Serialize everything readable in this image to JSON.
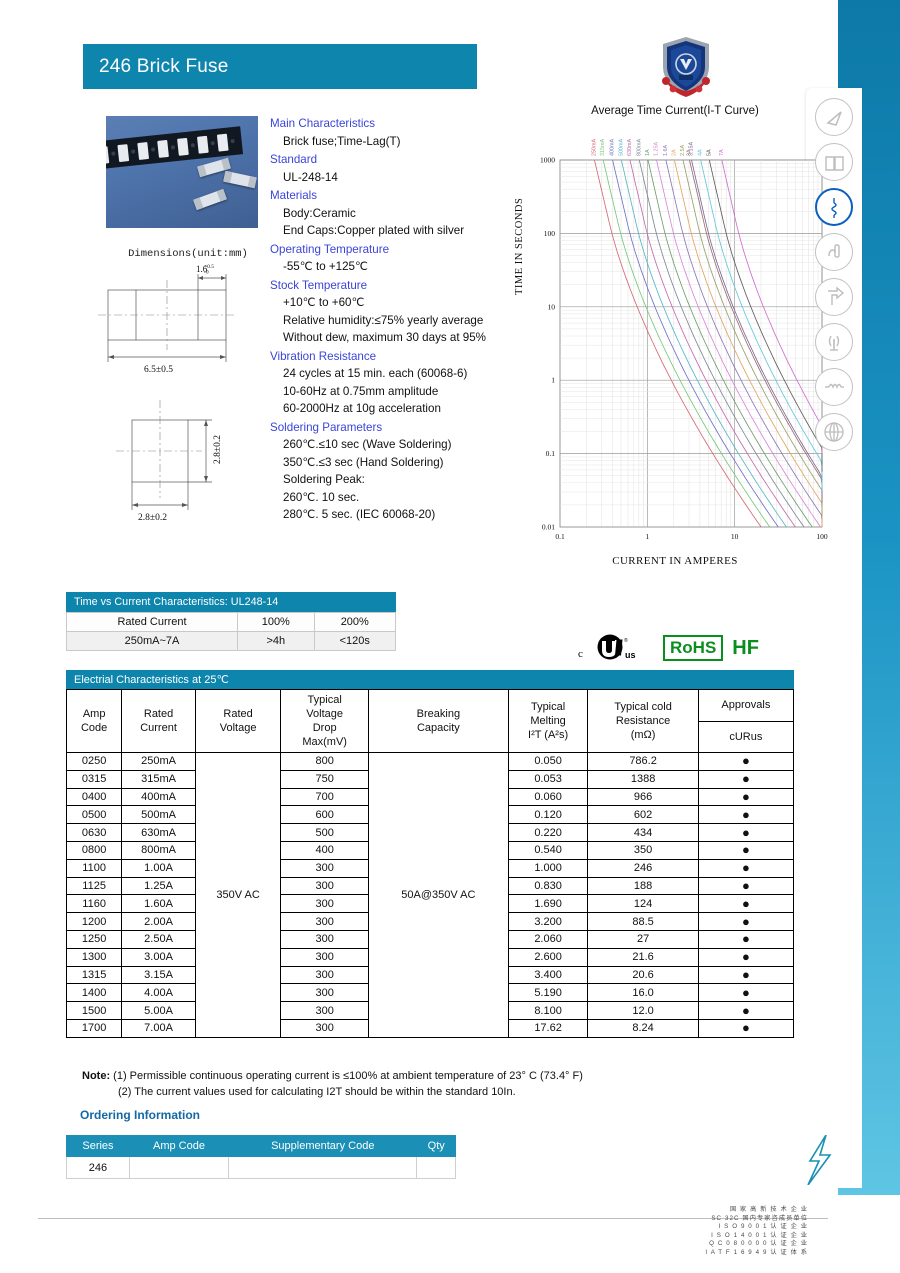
{
  "header": {
    "title": "246 Brick Fuse",
    "logo_icon": "shield-logo"
  },
  "product_photo_alt": "brick-fuse-product-photo",
  "dimensions": {
    "title": "Dimensions(unit:mm)",
    "length": "6.5±0.5",
    "endcap": "1.6",
    "endcap_tol_plus": "+0.5",
    "endcap_tol_minus": "-0",
    "width": "2.8±0.2",
    "height": "2.8±0.2"
  },
  "specs": [
    {
      "heading": "Main Characteristics",
      "values": [
        "Brick fuse;Time-Lag(T)"
      ]
    },
    {
      "heading": "Standard",
      "values": [
        "UL-248-14"
      ]
    },
    {
      "heading": "Materials",
      "values": [
        "Body:Ceramic",
        "End Caps:Copper plated with silver"
      ]
    },
    {
      "heading": "Operating Temperature",
      "values": [
        "-55℃ to +125℃"
      ]
    },
    {
      "heading": "Stock Temperature",
      "values": [
        "+10℃ to +60℃",
        "Relative humidity:≤75% yearly average",
        "Without dew, maximum 30 days at 95%"
      ]
    },
    {
      "heading": "Vibration Resistance",
      "values": [
        "24 cycles at 15 min. each (60068-6)",
        "10-60Hz at 0.75mm amplitude",
        "60-2000Hz at 10g acceleration"
      ]
    },
    {
      "heading": "Soldering Parameters",
      "values": [
        "260℃.≤10 sec (Wave Soldering)",
        "350℃.≤3 sec (Hand Soldering)",
        "Soldering Peak:",
        "260℃. 10 sec.",
        "280℃. 5 sec. (IEC 60068-20)"
      ]
    }
  ],
  "chart_data": {
    "type": "line",
    "title": "Average Time Current(I-T Curve)",
    "xlabel": "CURRENT IN AMPERES",
    "ylabel": "TIME IN SECONDS",
    "xscale": "log",
    "yscale": "log",
    "xlim": [
      0.1,
      100
    ],
    "ylim": [
      0.01,
      1000
    ],
    "xticks": [
      "0.1",
      "1",
      "10",
      "100"
    ],
    "yticks": [
      "0.01",
      "0.1",
      "1",
      "10",
      "100",
      "1000"
    ],
    "grid": true,
    "legend_position": "top-inline-rotated",
    "series": [
      {
        "name": "250mA",
        "color": "#d46a72",
        "i_at_10s": 0.62,
        "i_at_0p1s": 1.55
      },
      {
        "name": "315mA",
        "color": "#78c87a",
        "i_at_10s": 0.78,
        "i_at_0p1s": 1.95
      },
      {
        "name": "400mA",
        "color": "#6f74c4",
        "i_at_10s": 0.99,
        "i_at_0p1s": 2.45
      },
      {
        "name": "500mA",
        "color": "#58b6c9",
        "i_at_10s": 1.24,
        "i_at_0p1s": 3.05
      },
      {
        "name": "630mA",
        "color": "#c46ab0",
        "i_at_10s": 1.56,
        "i_at_0p1s": 3.85
      },
      {
        "name": "800mA",
        "color": "#7f8896",
        "i_at_10s": 1.98,
        "i_at_0p1s": 4.85
      },
      {
        "name": "1A",
        "color": "#6f9e6f",
        "i_at_10s": 2.48,
        "i_at_0p1s": 6.05
      },
      {
        "name": "1.25A",
        "color": "#d887d8",
        "i_at_10s": 3.1,
        "i_at_0p1s": 7.55
      },
      {
        "name": "1.6A",
        "color": "#8f78b8",
        "i_at_10s": 3.96,
        "i_at_0p1s": 9.6
      },
      {
        "name": "2A",
        "color": "#e0a663",
        "i_at_10s": 4.95,
        "i_at_0p1s": 12.0
      },
      {
        "name": "2.5A",
        "color": "#9a9f6a",
        "i_at_10s": 6.2,
        "i_at_0p1s": 15.0
      },
      {
        "name": "3A",
        "color": "#9a6f6f",
        "i_at_10s": 7.4,
        "i_at_0p1s": 18.0
      },
      {
        "name": "3.15A",
        "color": "#7d6a9a",
        "i_at_10s": 7.8,
        "i_at_0p1s": 19.0
      },
      {
        "name": "4A",
        "color": "#63c8dd",
        "i_at_10s": 9.9,
        "i_at_0p1s": 24.0
      },
      {
        "name": "5A",
        "color": "#5e5e5e",
        "i_at_10s": 12.4,
        "i_at_0p1s": 30.0
      },
      {
        "name": "7A",
        "color": "#cf6fcf",
        "i_at_10s": 17.3,
        "i_at_0p1s": 42.0
      }
    ]
  },
  "tvc_table": {
    "caption": "Time vs Current Characteristics: UL248-14",
    "header": [
      "Rated Current",
      "100%",
      "200%"
    ],
    "row": [
      "250mA~7A",
      ">4h",
      "<120s"
    ]
  },
  "marks": {
    "ul": "cULus-mark",
    "rohs": "RoHS",
    "hf": "HF"
  },
  "main_table": {
    "caption": "Electrial Characteristics at 25℃",
    "headers": {
      "amp_code": "Amp\nCode",
      "rated_current": "Rated\nCurrent",
      "rated_voltage": "Rated\nVoltage",
      "voltage_drop": "Typical\nVoltage\nDrop\nMax(mV)",
      "breaking": "Breaking\nCapacity",
      "melting": "Typical\nMelting\nI²T (A²s)",
      "resistance": "Typical cold\nResistance\n(mΩ)",
      "approvals": "Approvals",
      "approvals_sub": "cURus"
    },
    "rated_voltage_value": "350V AC",
    "breaking_value": "50A@350V AC",
    "approval_dot": "●",
    "rows": [
      {
        "code": "0250",
        "current": "250mA",
        "drop": "800",
        "melting": "0.050",
        "resistance": "786.2"
      },
      {
        "code": "0315",
        "current": "315mA",
        "drop": "750",
        "melting": "0.053",
        "resistance": "1388"
      },
      {
        "code": "0400",
        "current": "400mA",
        "drop": "700",
        "melting": "0.060",
        "resistance": "966"
      },
      {
        "code": "0500",
        "current": "500mA",
        "drop": "600",
        "melting": "0.120",
        "resistance": "602"
      },
      {
        "code": "0630",
        "current": "630mA",
        "drop": "500",
        "melting": "0.220",
        "resistance": "434"
      },
      {
        "code": "0800",
        "current": "800mA",
        "drop": "400",
        "melting": "0.540",
        "resistance": "350"
      },
      {
        "code": "1100",
        "current": "1.00A",
        "drop": "300",
        "melting": "1.000",
        "resistance": "246"
      },
      {
        "code": "1125",
        "current": "1.25A",
        "drop": "300",
        "melting": "0.830",
        "resistance": "188"
      },
      {
        "code": "1160",
        "current": "1.60A",
        "drop": "300",
        "melting": "1.690",
        "resistance": "124"
      },
      {
        "code": "1200",
        "current": "2.00A",
        "drop": "300",
        "melting": "3.200",
        "resistance": "88.5"
      },
      {
        "code": "1250",
        "current": "2.50A",
        "drop": "300",
        "melting": "2.060",
        "resistance": "27"
      },
      {
        "code": "1300",
        "current": "3.00A",
        "drop": "300",
        "melting": "2.600",
        "resistance": "21.6"
      },
      {
        "code": "1315",
        "current": "3.15A",
        "drop": "300",
        "melting": "3.400",
        "resistance": "20.6"
      },
      {
        "code": "1400",
        "current": "4.00A",
        "drop": "300",
        "melting": "5.190",
        "resistance": "16.0"
      },
      {
        "code": "1500",
        "current": "5.00A",
        "drop": "300",
        "melting": "8.100",
        "resistance": "12.0"
      },
      {
        "code": "1700",
        "current": "7.00A",
        "drop": "300",
        "melting": "17.62",
        "resistance": "8.24"
      }
    ]
  },
  "note": {
    "label": "Note:",
    "line1": "(1) Permissible continuous operating current is ≤100% at ambient temperature of 23° C (73.4° F)",
    "line2": "(2) The current values used for calculating I2T should be within the standard 10In."
  },
  "ordering": {
    "title": "Ordering Information",
    "headers": [
      "Series",
      "Amp Code",
      "Supplementary Code",
      "Qty"
    ],
    "row": [
      "246",
      "",
      "",
      ""
    ]
  },
  "footer_certs": [
    "国 家 高 新 技 术 企 业",
    "SC 32C 国内专家咨成员单位",
    "I S O    9 0 0 1  认 证 企 业",
    "I S O    1 4 0 0 1  认 证 企 业",
    "Q C  0 8 0 0 0 0   认 证 企 业",
    "I A T F  1 6 9 4 9  认 证 体 系"
  ],
  "rail_icons": [
    {
      "name": "compass-icon",
      "active": false
    },
    {
      "name": "book-icon",
      "active": false
    },
    {
      "name": "fuse-element-icon",
      "active": true
    },
    {
      "name": "hand-tool-icon",
      "active": false
    },
    {
      "name": "arrow-flag-icon",
      "active": false
    },
    {
      "name": "antenna-icon",
      "active": false
    },
    {
      "name": "waveform-icon",
      "active": false
    },
    {
      "name": "globe-icon",
      "active": false
    }
  ],
  "colors": {
    "brand_blue": "#0e85ad",
    "heading_blue": "#3b44d8",
    "green": "#0a8f1f",
    "active_blue": "#0b5fc0"
  }
}
